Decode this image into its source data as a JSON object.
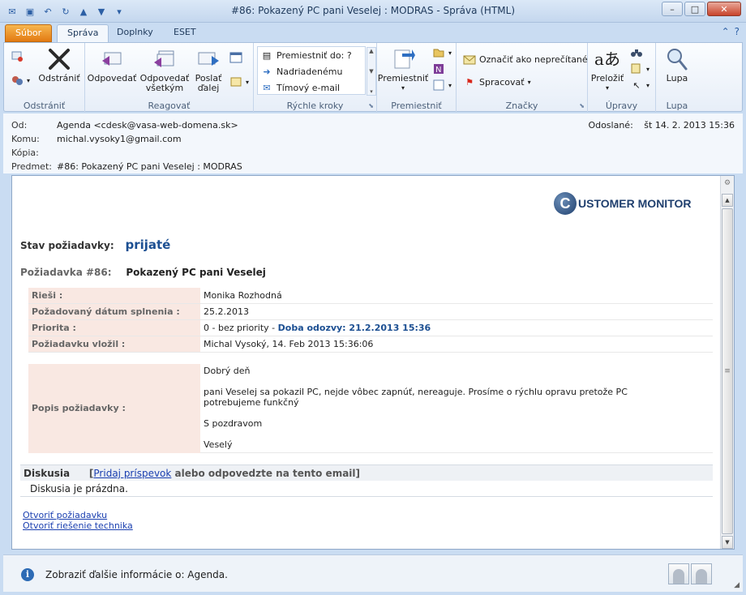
{
  "window": {
    "title": "#86: Pokazený PC pani Veselej : MODRAS  -  Správa (HTML)"
  },
  "tabs": {
    "file": "Súbor",
    "items": [
      "Správa",
      "Doplnky",
      "ESET"
    ]
  },
  "ribbon": {
    "delete_group": {
      "label": "Odstrániť",
      "delete_button": "Odstrániť"
    },
    "respond_group": {
      "label": "Reagovať",
      "reply": "Odpovedať",
      "reply_all_1": "Odpovedať",
      "reply_all_2": "všetkým",
      "forward_1": "Poslať",
      "forward_2": "ďalej"
    },
    "quick_steps": {
      "label": "Rýchle kroky",
      "items": [
        "Premiestniť do: ?",
        "Nadriadenému",
        "Tímový e-mail"
      ]
    },
    "move_group": {
      "label": "Premiestniť",
      "move_button": "Premiestniť"
    },
    "tags_group": {
      "label": "Značky",
      "mark_unread": "Označiť ako neprečítané",
      "followup": "Spracovať"
    },
    "editing_group": {
      "label": "Úpravy",
      "translate": "Preložiť"
    },
    "zoom_group": {
      "label": "Lupa",
      "zoom": "Lupa"
    }
  },
  "header": {
    "from_label": "Od:",
    "from_value": "Agenda <cdesk@vasa-web-domena.sk>",
    "to_label": "Komu:",
    "to_value": "michal.vysoky1@gmail.com",
    "cc_label": "Kópia:",
    "cc_value": "",
    "subject_label": "Predmet:",
    "subject_value": "#86: Pokazený PC pani Veselej : MODRAS",
    "sent_label": "Odoslané:",
    "sent_value": "št 14. 2. 2013 15:36"
  },
  "email": {
    "logo_letter": "C",
    "logo_text": "USTOMER MONITOR",
    "status_label": "Stav požiadavky:",
    "status_value": "prijaté",
    "request_label": "Požiadavka #86:",
    "request_title": "Pokazený PC pani Veselej",
    "fields": {
      "resolver_label": "Rieši :",
      "resolver_value": "Monika Rozhodná",
      "due_label": "Požadovaný dátum splnenia :",
      "due_value": "25.2.2013",
      "priority_label": "Priorita :",
      "priority_value": "0 - bez priority -",
      "priority_response": "Doba odozvy: 21.2.2013 15:36",
      "author_label": "Požiadavku vložil :",
      "author_value": "Michal Vysoký, 14. Feb 2013 15:36:06"
    },
    "description_label": "Popis požiadavky :",
    "description_lines": [
      "Dobrý deň",
      "pani Veselej sa pokazil PC, nejde vôbec zapnúť, nereaguje. Prosíme o rýchlu opravu pretože PC potrebujeme funkčný",
      "S pozdravom",
      "Veselý"
    ],
    "discussion_label": "Diskusia",
    "discussion_open": "[",
    "discussion_link": "Pridaj príspevok",
    "discussion_rest": " alebo odpovedzte na tento email]",
    "discussion_empty": "Diskusia je prázdna.",
    "link_open": "Otvoriť požiadavku",
    "link_solution": "Otvoriť riešenie technika"
  },
  "people_pane": {
    "text": "Zobraziť ďalšie informácie o: Agenda."
  },
  "colors": {
    "accent": "#1c4f92",
    "link": "#1a3fb0",
    "label_bg": "#f9e8e2",
    "file_tab": "#e37a12"
  }
}
